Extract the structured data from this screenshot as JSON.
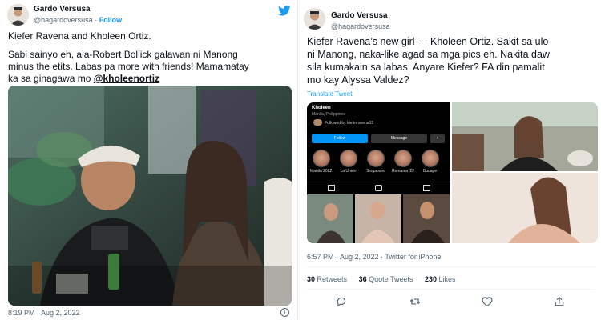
{
  "colors": {
    "accent": "#1d9bf0",
    "text": "#0f1419",
    "secondary": "#536471",
    "instagram_follow": "#0095f6"
  },
  "left_tweet": {
    "display_name": "Gardo Versusa",
    "handle": "@hagardoversusa",
    "separator": " · ",
    "follow_label": "Follow",
    "brand_icon": "twitter-bird-icon",
    "paragraph_1": "Kiefer Ravena and Kholeen Ortiz.",
    "paragraph_2_lines": [
      "Sabi sainyo eh, ala-Robert Bollick galawan ni Manong",
      "minus the etits. Labas pa more with friends! Mamamatay",
      "ka sa ginagawa mo "
    ],
    "mention": "@kholeenortiz",
    "timestamp": "8:19 PM · Aug 2, 2022",
    "info_icon": "info-icon"
  },
  "right_tweet": {
    "display_name": "Gardo Versusa",
    "handle": "@hagardoversusa",
    "text_lines": [
      "Kiefer Ravena’s new girl — Kholeen Ortiz. Sakit sa ulo",
      "ni Manong, naka-like agad sa mga pics eh. Nakita daw",
      "sila kumakain sa labas. Anyare Kiefer? FA din pamalit",
      "mo kay Alyssa Valdez?"
    ],
    "translate_label": "Translate Tweet",
    "instagram": {
      "name": "Kholeen",
      "location": "Manila, Philippines",
      "followed_by": "Followed by kieferravena15",
      "follow_button": "Follow",
      "message_button": "Message",
      "more_icon": "add-person-icon",
      "highlights": [
        "Manila 2022",
        "La Union",
        "Singapore",
        "Romania '22",
        "Budape"
      ]
    },
    "timestamp": "6:57 PM · Aug 2, 2022 · Twitter for iPhone",
    "stats": {
      "retweets_count": "30",
      "retweets_label": "Retweets",
      "quotes_count": "36",
      "quotes_label": "Quote Tweets",
      "likes_count": "230",
      "likes_label": "Likes"
    },
    "actions": [
      "reply-icon",
      "retweet-icon",
      "like-icon",
      "share-icon"
    ]
  }
}
